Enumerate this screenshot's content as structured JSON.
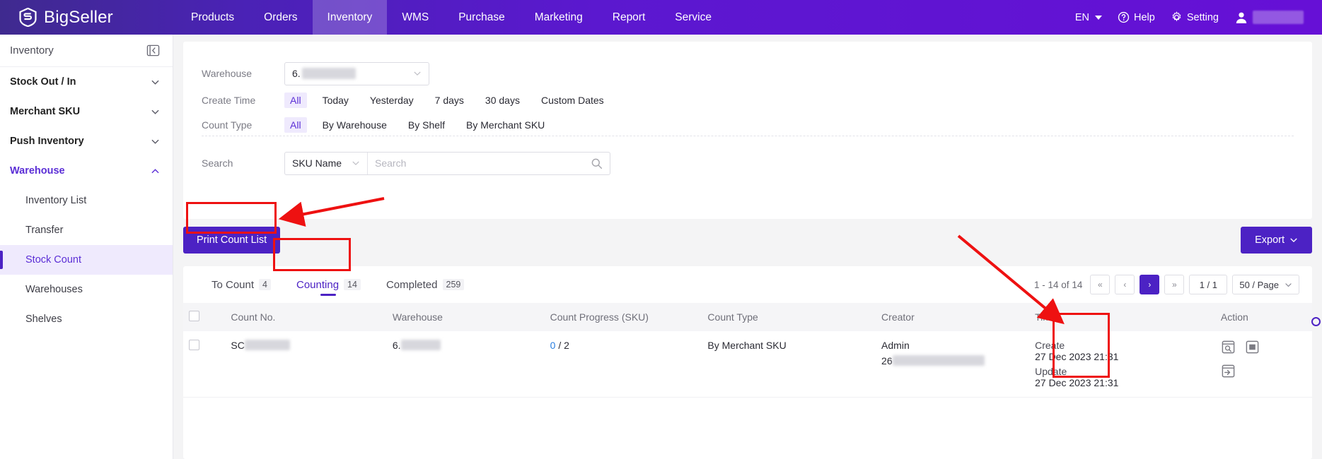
{
  "header": {
    "brand": "BigSeller",
    "nav": [
      {
        "label": "Products",
        "active": false
      },
      {
        "label": "Orders",
        "active": false
      },
      {
        "label": "Inventory",
        "active": true
      },
      {
        "label": "WMS",
        "active": false
      },
      {
        "label": "Purchase",
        "active": false
      },
      {
        "label": "Marketing",
        "active": false
      },
      {
        "label": "Report",
        "active": false
      },
      {
        "label": "Service",
        "active": false
      }
    ],
    "lang": "EN",
    "help": "Help",
    "setting": "Setting",
    "account_name": ""
  },
  "sidebar": {
    "title": "Inventory",
    "groups": [
      {
        "label": "Stock Out / In",
        "open": false
      },
      {
        "label": "Merchant SKU",
        "open": false
      },
      {
        "label": "Push Inventory",
        "open": false
      },
      {
        "label": "Warehouse",
        "open": true
      }
    ],
    "sub_items": [
      {
        "label": "Inventory List",
        "active": false
      },
      {
        "label": "Transfer",
        "active": false
      },
      {
        "label": "Stock Count",
        "active": true
      },
      {
        "label": "Warehouses",
        "active": false
      },
      {
        "label": "Shelves",
        "active": false
      }
    ]
  },
  "filters": {
    "warehouse_label": "Warehouse",
    "warehouse_value": "6.",
    "create_time_label": "Create Time",
    "create_time_options": [
      "All",
      "Today",
      "Yesterday",
      "7 days",
      "30 days",
      "Custom Dates"
    ],
    "create_time_selected": "All",
    "count_type_label": "Count Type",
    "count_type_options": [
      "All",
      "By Warehouse",
      "By Shelf",
      "By Merchant SKU"
    ],
    "count_type_selected": "All",
    "search_label": "Search",
    "search_type": "SKU Name",
    "search_placeholder": "Search",
    "search_value": ""
  },
  "toolbar": {
    "print_count_list": "Print Count List",
    "export": "Export"
  },
  "tabs": [
    {
      "label": "To Count",
      "count": "4",
      "active": false
    },
    {
      "label": "Counting",
      "count": "14",
      "active": true
    },
    {
      "label": "Completed",
      "count": "259",
      "active": false
    }
  ],
  "pagination": {
    "range": "1 - 14 of 14",
    "first": "«",
    "prev": "‹",
    "next": "›",
    "last": "»",
    "page": "1 / 1",
    "page_size": "50 / Page"
  },
  "table": {
    "columns": [
      "Count No.",
      "Warehouse",
      "Count Progress (SKU)",
      "Count Type",
      "Creator",
      "Time",
      "Action"
    ],
    "rows": [
      {
        "count_no": "SC",
        "warehouse": "6.",
        "progress_done": "0",
        "progress_total": "2",
        "count_type": "By Merchant SKU",
        "creator_name": "Admin",
        "creator_id": "26",
        "create_label": "Create",
        "create_time": "27 Dec 2023 21:31",
        "update_label": "Update",
        "update_time": "27 Dec 2023 21:31"
      }
    ]
  },
  "colors": {
    "brand_purple": "#4c22c4",
    "header_purple": "#5b18cf",
    "accent_link": "#2a7fe0",
    "annotation_red": "#ee1111"
  }
}
